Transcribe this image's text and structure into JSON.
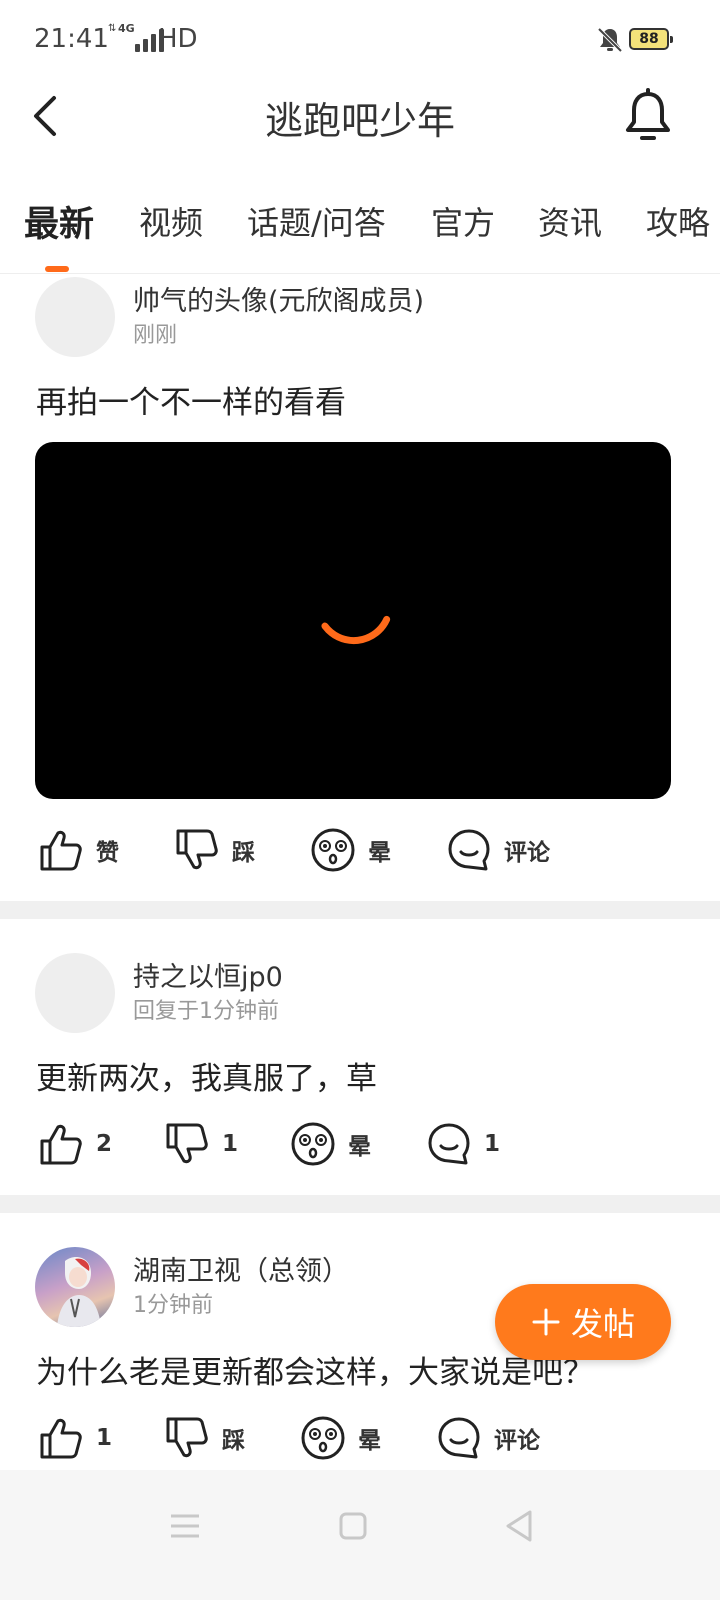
{
  "status_bar": {
    "time": "21:41",
    "network": "4G",
    "hd": "HD",
    "battery": "88"
  },
  "header": {
    "title": "逃跑吧少年"
  },
  "tabs": [
    {
      "label": "最新",
      "active": true
    },
    {
      "label": "视频",
      "active": false
    },
    {
      "label": "话题/问答",
      "active": false
    },
    {
      "label": "官方",
      "active": false
    },
    {
      "label": "资讯",
      "active": false
    },
    {
      "label": "攻略",
      "active": false
    }
  ],
  "posts": [
    {
      "author": "帅气的头像(元欣阁成员)",
      "time": "刚刚",
      "text": "再拍一个不一样的看看",
      "actions": {
        "like": "赞",
        "dislike": "踩",
        "dizzy": "晕",
        "comment": "评论"
      }
    },
    {
      "author": "持之以恒jp0",
      "time": "回复于1分钟前",
      "text": "更新两次，我真服了，草",
      "actions": {
        "like": "2",
        "dislike": "1",
        "dizzy": "晕",
        "comment": "1"
      }
    },
    {
      "author": "湖南卫视（总领）",
      "time": "1分钟前",
      "text": "为什么老是更新都会这样，大家说是吧？",
      "actions": {
        "like": "1",
        "dislike": "踩",
        "dizzy": "晕",
        "comment": "评论"
      }
    }
  ],
  "fab": {
    "label": "发帖"
  },
  "colors": {
    "accent": "#ff7a1c",
    "divider": "#f0f0f0"
  }
}
